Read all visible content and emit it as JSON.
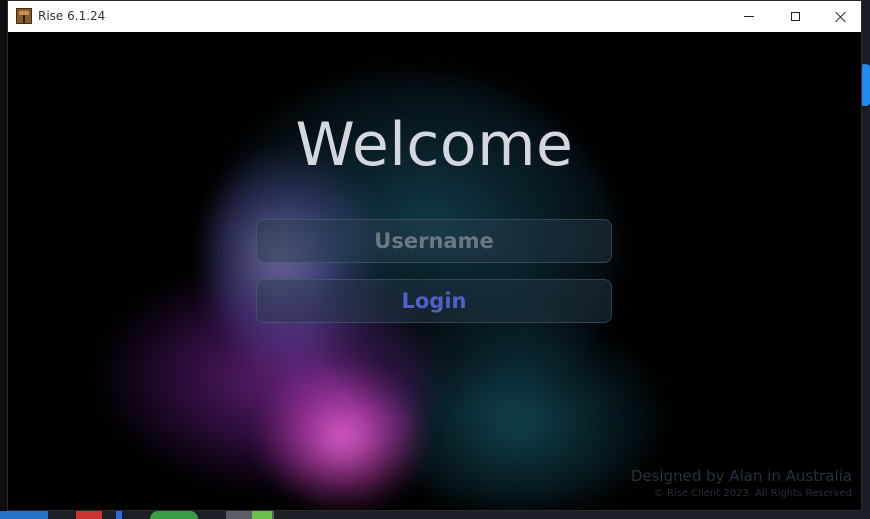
{
  "window": {
    "title": "Rise 6.1.24"
  },
  "icons": {
    "app": "app-logo-icon",
    "minimize": "minimize-icon",
    "maximize": "maximize-icon",
    "close": "close-icon"
  },
  "main": {
    "heading": "Welcome",
    "username": {
      "placeholder": "Username",
      "value": ""
    },
    "login_label": "Login"
  },
  "footer": {
    "credit": "Designed by Alan in Australia",
    "copyright": "© Rise Client 2023. All Rights Reserved"
  },
  "colors": {
    "heading": "#d4d8de",
    "login_text": "#5060c8",
    "placeholder": "#6a7884",
    "glow_pink": "#ff6ee6",
    "glow_teal": "#14465a"
  }
}
